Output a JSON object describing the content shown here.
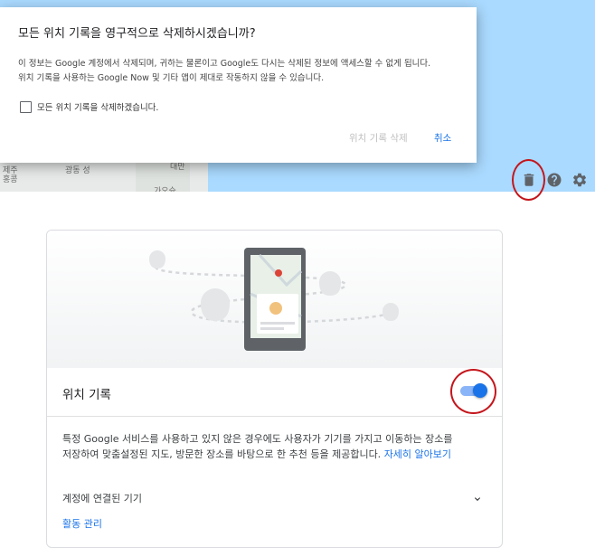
{
  "map": {
    "labels": [
      "제주",
      "광동 성",
      "대만",
      "가오슝",
      "홍콩"
    ],
    "toolbar": {
      "delete_icon": "trash-icon",
      "help_icon": "help-icon",
      "settings_icon": "gear-icon"
    }
  },
  "dialog": {
    "title": "모든 위치 기록을 영구적으로 삭제하시겠습니까?",
    "body_line1": "이 정보는 Google 계정에서 삭제되며, 귀하는 물론이고 Google도 다시는 삭제된 정보에 액세스할 수 없게 됩니다.",
    "body_line2": "위치 기록을 사용하는 Google Now 및 기타 앱이 제대로 작동하지 않을 수 있습니다.",
    "checkbox_label": "모든 위치 기록을 삭제하겠습니다.",
    "delete_button": "위치 기록 삭제",
    "cancel_button": "취소"
  },
  "card": {
    "title": "위치 기록",
    "toggle_on": true,
    "description_main": "특정 Google 서비스를 사용하고 있지 않은 경우에도 사용자가 기기를 가지고 이동하는 장소를 저장하여 맞춤설정된 지도, 방문한 장소를 바탕으로 한 추천 등을 제공합니다.",
    "learn_more": "자세히 알아보기",
    "devices_label": "계정에 연결된 기기",
    "manage_activity": "활동 관리"
  },
  "colors": {
    "accent": "#1a73e8",
    "annotation_red": "#c4161c",
    "map_water": "#aadaff"
  }
}
